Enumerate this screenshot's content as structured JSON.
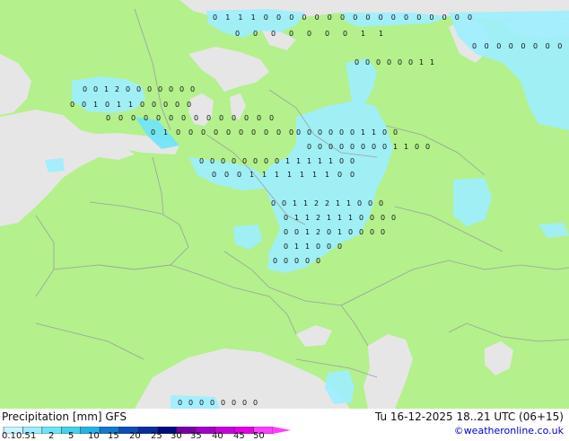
{
  "legend": {
    "title": "Precipitation [mm] GFS",
    "validity": "Tu 16-12-2025 18..21 UTC (06+15)",
    "credit": "©weatheronline.co.uk",
    "ticks": [
      "0.1",
      "0.5",
      "1",
      "2",
      "5",
      "10",
      "15",
      "20",
      "25",
      "30",
      "35",
      "40",
      "45",
      "50"
    ],
    "colors": [
      "#c8f5ff",
      "#9ceeff",
      "#6ee4fa",
      "#44d2f0",
      "#22b4e6",
      "#1478cc",
      "#0a50b4",
      "#0a2ea0",
      "#000c82",
      "#7800a0",
      "#a000c8",
      "#c800dc",
      "#e600e6",
      "#ff3cff"
    ]
  },
  "map": {
    "land_color": "#b4f08c",
    "sea_color": "#e6e6e6",
    "border_color": "#9aa0a0",
    "precip_light": "#9ceeff",
    "precip_medium": "#6ee4fa",
    "markers": [
      {
        "lat": "upper-left",
        "labels": [
          "1",
          "1",
          "1"
        ]
      },
      {
        "labels": [
          "0",
          "0",
          "0",
          "0"
        ]
      }
    ]
  },
  "markers": {
    "r1": [
      "0",
      "1",
      "1",
      "1",
      "0",
      "0",
      "0",
      "0",
      "0",
      "0",
      "0",
      "0",
      "0",
      "0",
      "0",
      "0",
      "0",
      "0",
      "0",
      "0",
      "0"
    ],
    "r2": [
      "0",
      "0",
      "0",
      "0",
      "0",
      "0",
      "0",
      "1",
      "1"
    ],
    "r3": [
      "0",
      "0",
      "0",
      "0",
      "0",
      "0",
      "0",
      "0",
      "0",
      "0",
      "0"
    ],
    "r4": [
      "0",
      "0",
      "0",
      "0",
      "0",
      "0",
      "1",
      "1"
    ],
    "r5": [
      "0",
      "0",
      "1",
      "2",
      "0",
      "0",
      "0",
      "0",
      "0",
      "0",
      "0"
    ],
    "r6": [
      "0",
      "0",
      "1",
      "0",
      "1",
      "1",
      "0",
      "0",
      "0",
      "0",
      "0"
    ],
    "r7": [
      "0",
      "0",
      "0",
      "0",
      "0",
      "0",
      "0",
      "0",
      "0",
      "0",
      "0",
      "0",
      "0",
      "0"
    ],
    "r8": [
      "0",
      "1",
      "0",
      "0",
      "0",
      "0",
      "0",
      "0",
      "0",
      "0",
      "0",
      "0"
    ],
    "r9": [
      "0",
      "0",
      "0",
      "0",
      "0",
      "0",
      "1",
      "1",
      "0",
      "0"
    ],
    "r10": [
      "0",
      "0",
      "0",
      "0",
      "0",
      "0",
      "0",
      "0",
      "1",
      "1",
      "0",
      "0"
    ],
    "r11": [
      "0",
      "0",
      "0",
      "0",
      "0",
      "0",
      "0",
      "0",
      "1",
      "1",
      "1",
      "1",
      "1",
      "0",
      "0"
    ],
    "r12": [
      "0",
      "0",
      "0",
      "1",
      "1",
      "1",
      "1",
      "1",
      "1",
      "1",
      "0",
      "0"
    ],
    "r13": [
      "0",
      "0",
      "1",
      "1",
      "2",
      "2",
      "1",
      "1",
      "0",
      "0",
      "0"
    ],
    "r14": [
      "0",
      "1",
      "1",
      "2",
      "1",
      "1",
      "1",
      "0",
      "0",
      "0",
      "0"
    ],
    "r15": [
      "0",
      "0",
      "1",
      "2",
      "0",
      "1",
      "0",
      "0",
      "0",
      "0"
    ],
    "r16": [
      "0",
      "1",
      "1",
      "0",
      "0",
      "0"
    ],
    "r17": [
      "0",
      "0",
      "0",
      "0",
      "0"
    ],
    "r18": [
      "0",
      "0",
      "0",
      "0",
      "0",
      "0",
      "0",
      "0"
    ]
  }
}
